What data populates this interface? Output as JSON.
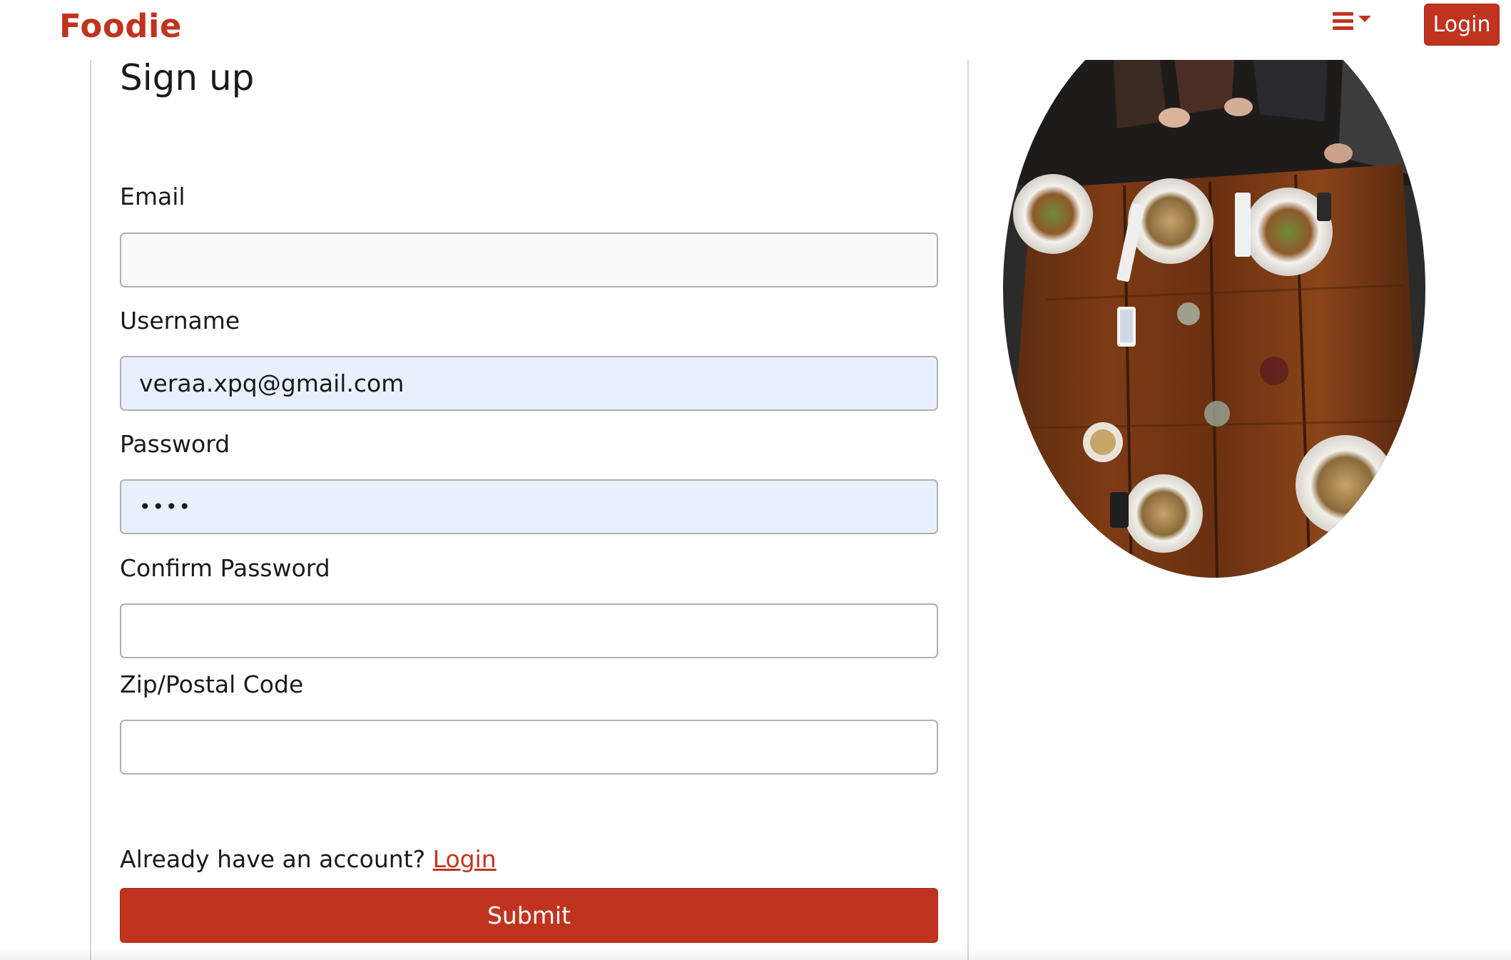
{
  "navbar": {
    "brand": "Foodie",
    "menu_icon": "hamburger-dropdown-icon",
    "login_label": "Login"
  },
  "form": {
    "title": "Sign up",
    "fields": [
      {
        "label": "Email",
        "value": ""
      },
      {
        "label": "Username",
        "value": "veraa.xpq@gmail.com"
      },
      {
        "label": "Password",
        "value": "••••"
      },
      {
        "label": "Confirm Password",
        "value": ""
      },
      {
        "label": "Zip/Postal Code",
        "value": ""
      }
    ],
    "already_text": "Already have an account?",
    "login_link": "Login",
    "submit_label": "Submit"
  },
  "colors": {
    "brand": "#c0341f",
    "autofill_bg": "#e8f0fd"
  }
}
